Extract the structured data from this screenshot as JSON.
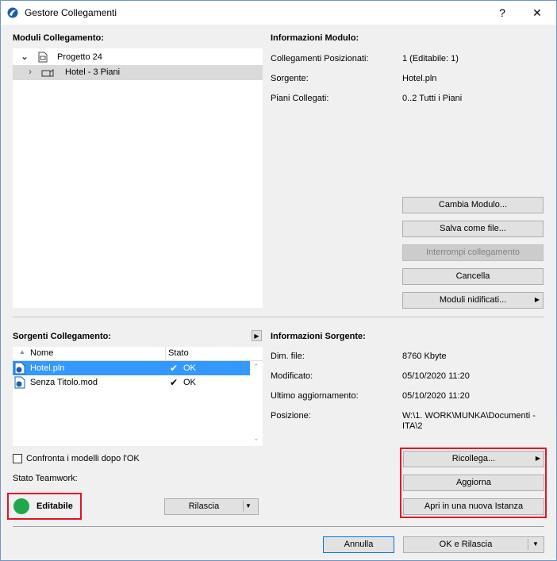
{
  "window": {
    "title": "Gestore Collegamenti",
    "help": "?",
    "close": "✕"
  },
  "modules": {
    "label": "Moduli Collegamento:",
    "tree": [
      {
        "label": "Progetto 24",
        "toggle": "⌄"
      },
      {
        "label": "Hotel - 3 Piani",
        "toggle": "›"
      }
    ]
  },
  "module_info": {
    "label": "Informazioni Modulo:",
    "rows": [
      {
        "key": "Collegamenti Posizionati:",
        "value": "1 (Editabile: 1)"
      },
      {
        "key": "Sorgente:",
        "value": "Hotel.pln"
      },
      {
        "key": "Piani Collegati:",
        "value": "0..2 Tutti i Piani"
      }
    ],
    "buttons": {
      "change": "Cambia Modulo...",
      "save": "Salva come file...",
      "break": "Interrompi collegamento",
      "delete": "Cancella",
      "nested": "Moduli nidificati..."
    }
  },
  "sources": {
    "label": "Sorgenti Collegamento:",
    "columns": {
      "name": "Nome",
      "status": "Stato"
    },
    "rows": [
      {
        "name": "Hotel.pln",
        "check": "✔",
        "status": "OK"
      },
      {
        "name": "Senza Titolo.mod",
        "check": "✔",
        "status": "OK"
      }
    ]
  },
  "source_info": {
    "label": "Informazioni Sorgente:",
    "rows": [
      {
        "key": "Dim. file:",
        "value": "8760 Kbyte"
      },
      {
        "key": "Modificato:",
        "value": "05/10/2020 11:20"
      },
      {
        "key": "Ultimo aggiornamento:",
        "value": "05/10/2020 11:20"
      },
      {
        "key": "Posizione:",
        "value_line1": "W:\\1. WORK\\MUNKA\\Documenti -",
        "value_line2": "ITA\\2"
      }
    ],
    "buttons": {
      "relink": "Ricollega...",
      "update": "Aggiorna",
      "open_new": "Apri in una nuova Istanza"
    }
  },
  "compare_label": "Confronta i modelli dopo l'OK",
  "teamwork": {
    "label": "Stato Teamwork:",
    "status": "Editabile",
    "status_color": "#1ea84a",
    "release": "Rilascia"
  },
  "footer": {
    "cancel": "Annulla",
    "ok_release": "OK e Rilascia"
  },
  "colors": {
    "highlight": "#e81123",
    "selection": "#3399ff"
  }
}
